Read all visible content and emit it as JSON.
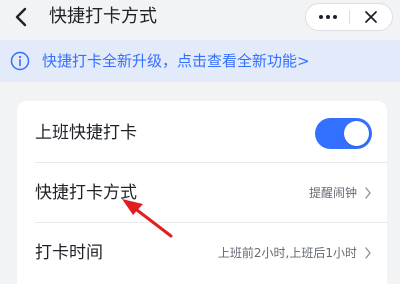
{
  "header": {
    "title": "快捷打卡方式",
    "back_icon": "chevron-left-icon",
    "more_icon": "more-dots-icon",
    "close_icon": "close-icon"
  },
  "notice": {
    "icon": "info-icon",
    "text": "快捷打卡全新升级，点击查看全新功能>",
    "color": "#3370ff",
    "background": "#e3ebfb"
  },
  "settings": {
    "items": [
      {
        "label": "上班快捷打卡",
        "toggle_on": true
      },
      {
        "label": "快捷打卡方式",
        "value": "提醒闹钟"
      },
      {
        "label": "打卡时间",
        "value": "上班前2小时,上班后1小时"
      }
    ]
  },
  "colors": {
    "accent": "#3370ff",
    "page_background": "#f2f3f5",
    "annotation_arrow": "#e02020"
  }
}
